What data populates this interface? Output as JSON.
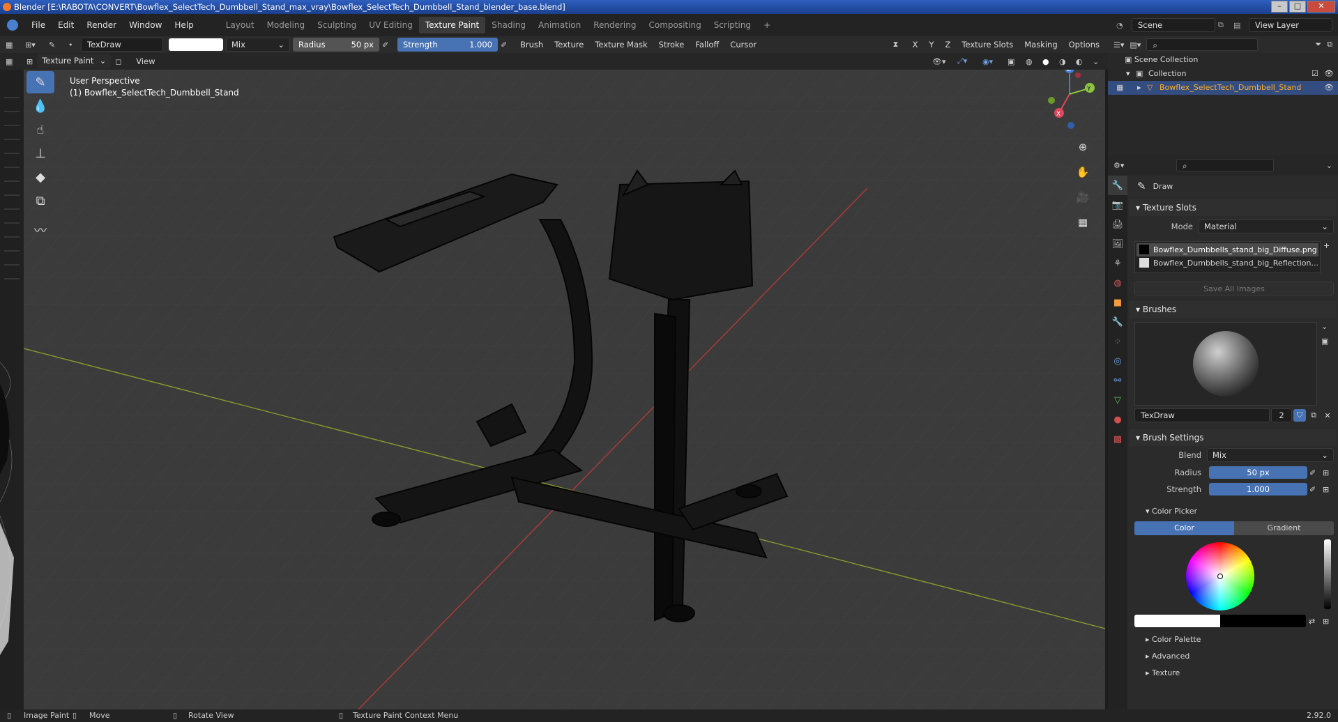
{
  "window": {
    "title": "Blender [E:\\RABOTA\\CONVERT\\Bowflex_SelectTech_Dumbbell_Stand_max_vray\\Bowflex_SelectTech_Dumbbell_Stand_blender_base.blend]",
    "buttons": [
      "–",
      "□",
      "✕"
    ]
  },
  "menu": [
    "File",
    "Edit",
    "Render",
    "Window",
    "Help"
  ],
  "workspaces": [
    "Layout",
    "Modeling",
    "Sculpting",
    "UV Editing",
    "Texture Paint",
    "Shading",
    "Animation",
    "Rendering",
    "Compositing",
    "Scripting"
  ],
  "active_workspace": "Texture Paint",
  "scene": {
    "label": "Scene",
    "view_layer": "View Layer"
  },
  "toolheader": {
    "brush_name": "TexDraw",
    "blend": "Mix",
    "radius_label": "Radius",
    "radius_value": "50 px",
    "strength_label": "Strength",
    "strength_value": "1.000",
    "menus": [
      "Brush",
      "Texture",
      "Texture Mask",
      "Stroke",
      "Falloff",
      "Cursor"
    ],
    "axes": [
      "X",
      "Y",
      "Z"
    ],
    "right_menus": [
      "Texture Slots",
      "Masking",
      "Options"
    ]
  },
  "viewheader": {
    "mode": "Texture Paint",
    "view": "View"
  },
  "viewport": {
    "perspective": "User Perspective",
    "object": "(1) Bowflex_SelectTech_Dumbbell_Stand",
    "gizmo": {
      "z": "Z",
      "y": "Y",
      "x": "X"
    },
    "colors": {
      "x_axis": "#a33a3a",
      "y_axis": "#7a9a2e",
      "z": "#3f7fdd",
      "y": "#8cc63f",
      "x": "#e0455c"
    }
  },
  "outliner": {
    "root": "Scene Collection",
    "collection": "Collection",
    "object": "Bowflex_SelectTech_Dumbbell_Stand"
  },
  "properties": {
    "tool_name": "Draw",
    "texture_slots": {
      "header": "Texture Slots",
      "mode_label": "Mode",
      "mode_value": "Material",
      "slots": [
        "Bowflex_Dumbbells_stand_big_Diffuse.png",
        "Bowflex_Dumbbells_stand_big_Reflection..."
      ],
      "save_all": "Save All Images"
    },
    "brushes": {
      "header": "Brushes",
      "name": "TexDraw",
      "users": "2"
    },
    "brush_settings": {
      "header": "Brush Settings",
      "blend_label": "Blend",
      "blend_value": "Mix",
      "radius_label": "Radius",
      "radius_value": "50 px",
      "strength_label": "Strength",
      "strength_value": "1.000"
    },
    "color_picker": {
      "header": "Color Picker",
      "tab_color": "Color",
      "tab_gradient": "Gradient"
    },
    "collapsed": [
      "Color Palette",
      "Advanced",
      "Texture"
    ]
  },
  "status": {
    "items": [
      "Image Paint",
      "Move",
      "Rotate View",
      "Texture Paint Context Menu"
    ],
    "version": "2.92.0"
  }
}
